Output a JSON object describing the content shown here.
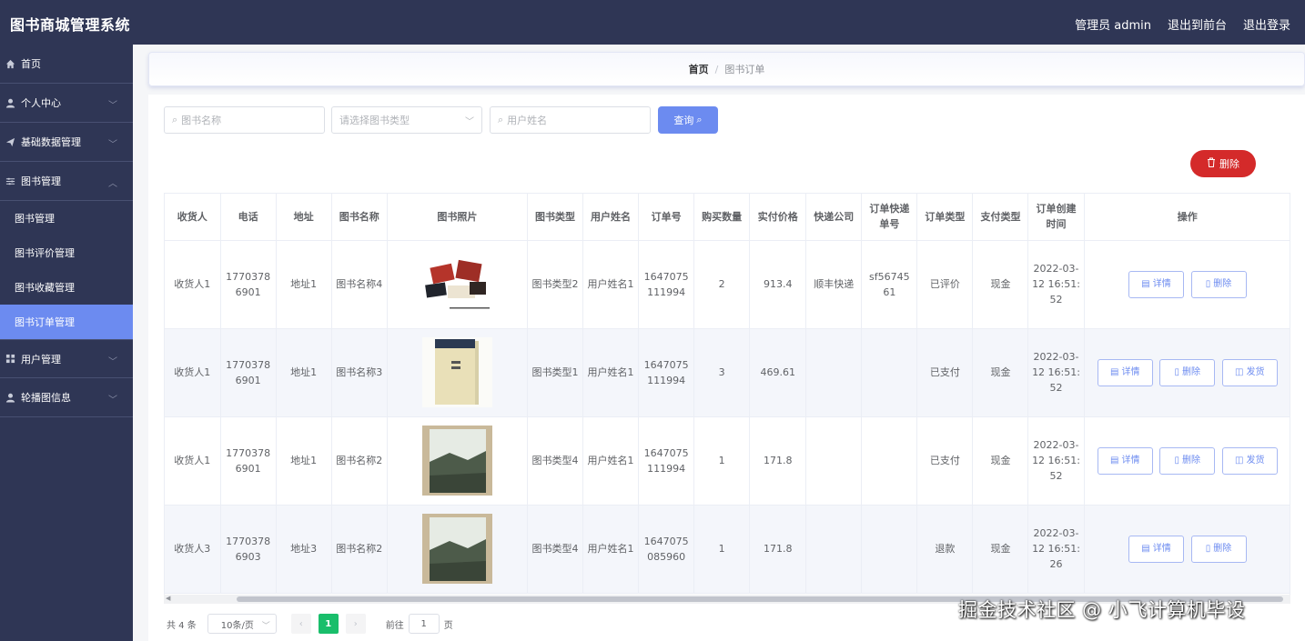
{
  "app": {
    "title": "图书商城管理系统"
  },
  "topbar": {
    "admin": "管理员 admin",
    "to_front": "退出到前台",
    "logout": "退出登录"
  },
  "sidebar": {
    "home": "首页",
    "personal": "个人中心",
    "basic_data": "基础数据管理",
    "book_mgmt": "图书管理",
    "sub": [
      "图书管理",
      "图书评价管理",
      "图书收藏管理",
      "图书订单管理"
    ],
    "user_mgmt": "用户管理",
    "carousel": "轮播图信息"
  },
  "breadcrumb": {
    "home": "首页",
    "sep": "/",
    "current": "图书订单"
  },
  "search": {
    "book_name_placeholder": "图书名称",
    "book_type_placeholder": "请选择图书类型",
    "user_name_placeholder": "用户姓名",
    "query_label": "查询"
  },
  "toolbar": {
    "delete_label": "删除"
  },
  "table": {
    "headers": [
      "收货人",
      "电话",
      "地址",
      "图书名称",
      "图书照片",
      "图书类型",
      "用户姓名",
      "订单号",
      "购买数量",
      "实付价格",
      "快递公司",
      "订单快递单号",
      "订单类型",
      "支付类型",
      "订单创建时间",
      "操作"
    ],
    "rows": [
      {
        "receiver": "收货人1",
        "phone": "17703786901",
        "address": "地址1",
        "book_name": "图书名称4",
        "book_type": "图书类型2",
        "user_name": "用户姓名1",
        "order_no": "1647075111994",
        "qty": "2",
        "price": "913.4",
        "courier": "顺丰快递",
        "tracking": "sf56745 61",
        "order_type": "已评价",
        "pay_type": "现金",
        "created": "2022-03-12 16:51:52",
        "actions": [
          "详情",
          "删除"
        ]
      },
      {
        "receiver": "收货人1",
        "phone": "17703786901",
        "address": "地址1",
        "book_name": "图书名称3",
        "book_type": "图书类型1",
        "user_name": "用户姓名1",
        "order_no": "1647075111994",
        "qty": "3",
        "price": "469.61",
        "courier": "",
        "tracking": "",
        "order_type": "已支付",
        "pay_type": "现金",
        "created": "2022-03-12 16:51:52",
        "actions": [
          "详情",
          "删除",
          "发货"
        ]
      },
      {
        "receiver": "收货人1",
        "phone": "17703786901",
        "address": "地址1",
        "book_name": "图书名称2",
        "book_type": "图书类型4",
        "user_name": "用户姓名1",
        "order_no": "1647075111994",
        "qty": "1",
        "price": "171.8",
        "courier": "",
        "tracking": "",
        "order_type": "已支付",
        "pay_type": "现金",
        "created": "2022-03-12 16:51:52",
        "actions": [
          "详情",
          "删除",
          "发货"
        ]
      },
      {
        "receiver": "收货人3",
        "phone": "17703786903",
        "address": "地址3",
        "book_name": "图书名称2",
        "book_type": "图书类型4",
        "user_name": "用户姓名1",
        "order_no": "1647075085960",
        "qty": "1",
        "price": "171.8",
        "courier": "",
        "tracking": "",
        "order_type": "退款",
        "pay_type": "现金",
        "created": "2022-03-12 16:51:26",
        "actions": [
          "详情",
          "删除"
        ]
      }
    ]
  },
  "pager": {
    "total": "共 4 条",
    "page_size": "10条/页",
    "current": "1",
    "goto_prefix": "前往",
    "goto_value": "1",
    "goto_suffix": "页"
  },
  "watermark": "掘金技术社区 @ 小飞计算机毕设",
  "colors": {
    "nav_bg": "#2f3655",
    "accent": "#6c8bf0",
    "danger": "#d42a2a",
    "page_active": "#19be6b"
  }
}
